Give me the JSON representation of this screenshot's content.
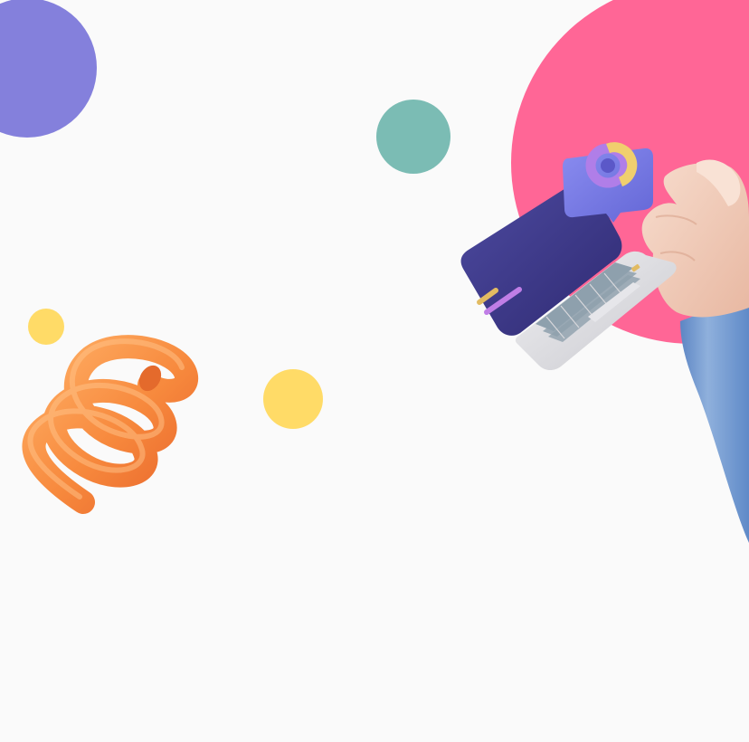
{
  "scene": {
    "background_color": "#fafafa",
    "colors": {
      "purple_circle": "#8480dc",
      "teal_circle": "#7bbcb4",
      "pink_circle": "#ff6696",
      "yellow_circle": "#ffdb67",
      "spring_orange": "#f7893d",
      "spring_light": "#ffb066",
      "laptop_screen": "#3f3a8a",
      "laptop_base": "#d8d8dc",
      "keyboard_keys": "#8ea0ad",
      "chat_bubble": "#7b7de6",
      "donut_purple": "#b07ee8",
      "donut_yellow": "#f0cf6e",
      "hand_skin": "#f2cdbb",
      "sleeve_blue": "#6c9ad2",
      "pen_yellow": "#e2bb62",
      "pen_purple": "#c07ee6"
    },
    "icons": [
      "coil-spring-icon",
      "laptop-icon",
      "chat-bubble-icon",
      "donut-chart-icon",
      "hand-icon"
    ]
  }
}
